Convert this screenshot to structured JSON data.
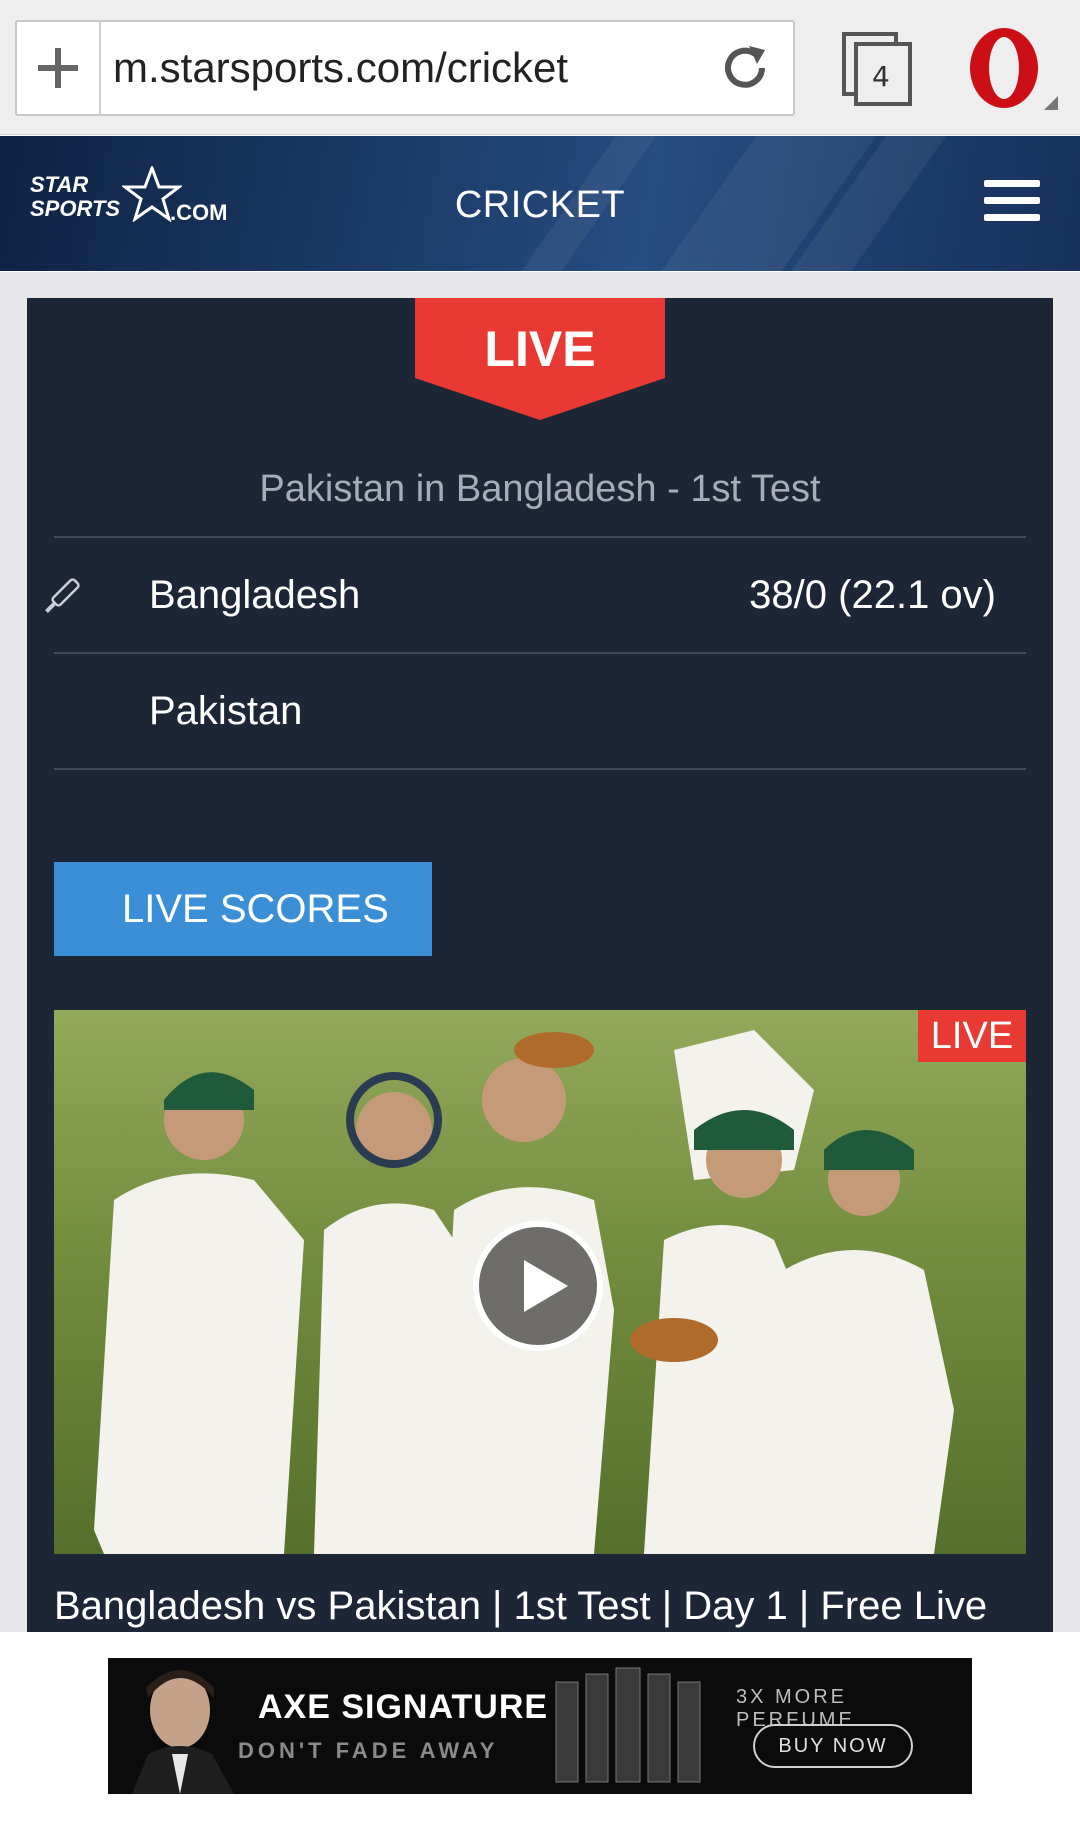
{
  "browser": {
    "url": "m.starsports.com/cricket",
    "tab_count": "4"
  },
  "header": {
    "logo_line1": "STAR",
    "logo_line2": "SPORTS",
    "logo_suffix": ".COM",
    "section_title": "CRICKET"
  },
  "match": {
    "live_badge": "LIVE",
    "title": "Pakistan in Bangladesh - 1st Test",
    "teams": [
      {
        "name": "Bangladesh",
        "score": "38/0 (22.1  ov)",
        "batting": true
      },
      {
        "name": "Pakistan",
        "score": "",
        "batting": false
      }
    ],
    "live_scores_button": "LIVE SCORES"
  },
  "video": {
    "live_badge": "LIVE",
    "title": "Bangladesh vs Pakistan | 1st Test | Day 1 | Free Live"
  },
  "ad": {
    "brand": "AXE SIGNATURE",
    "tagline": "DON'T FADE AWAY",
    "more": "3X MORE PERFUME",
    "cta": "BUY NOW"
  },
  "colors": {
    "live_red": "#e83a33",
    "button_blue": "#3a8fd6",
    "card_bg": "#1c2636",
    "header_navy": "#1b3a66",
    "opera_red": "#cc0f16"
  }
}
